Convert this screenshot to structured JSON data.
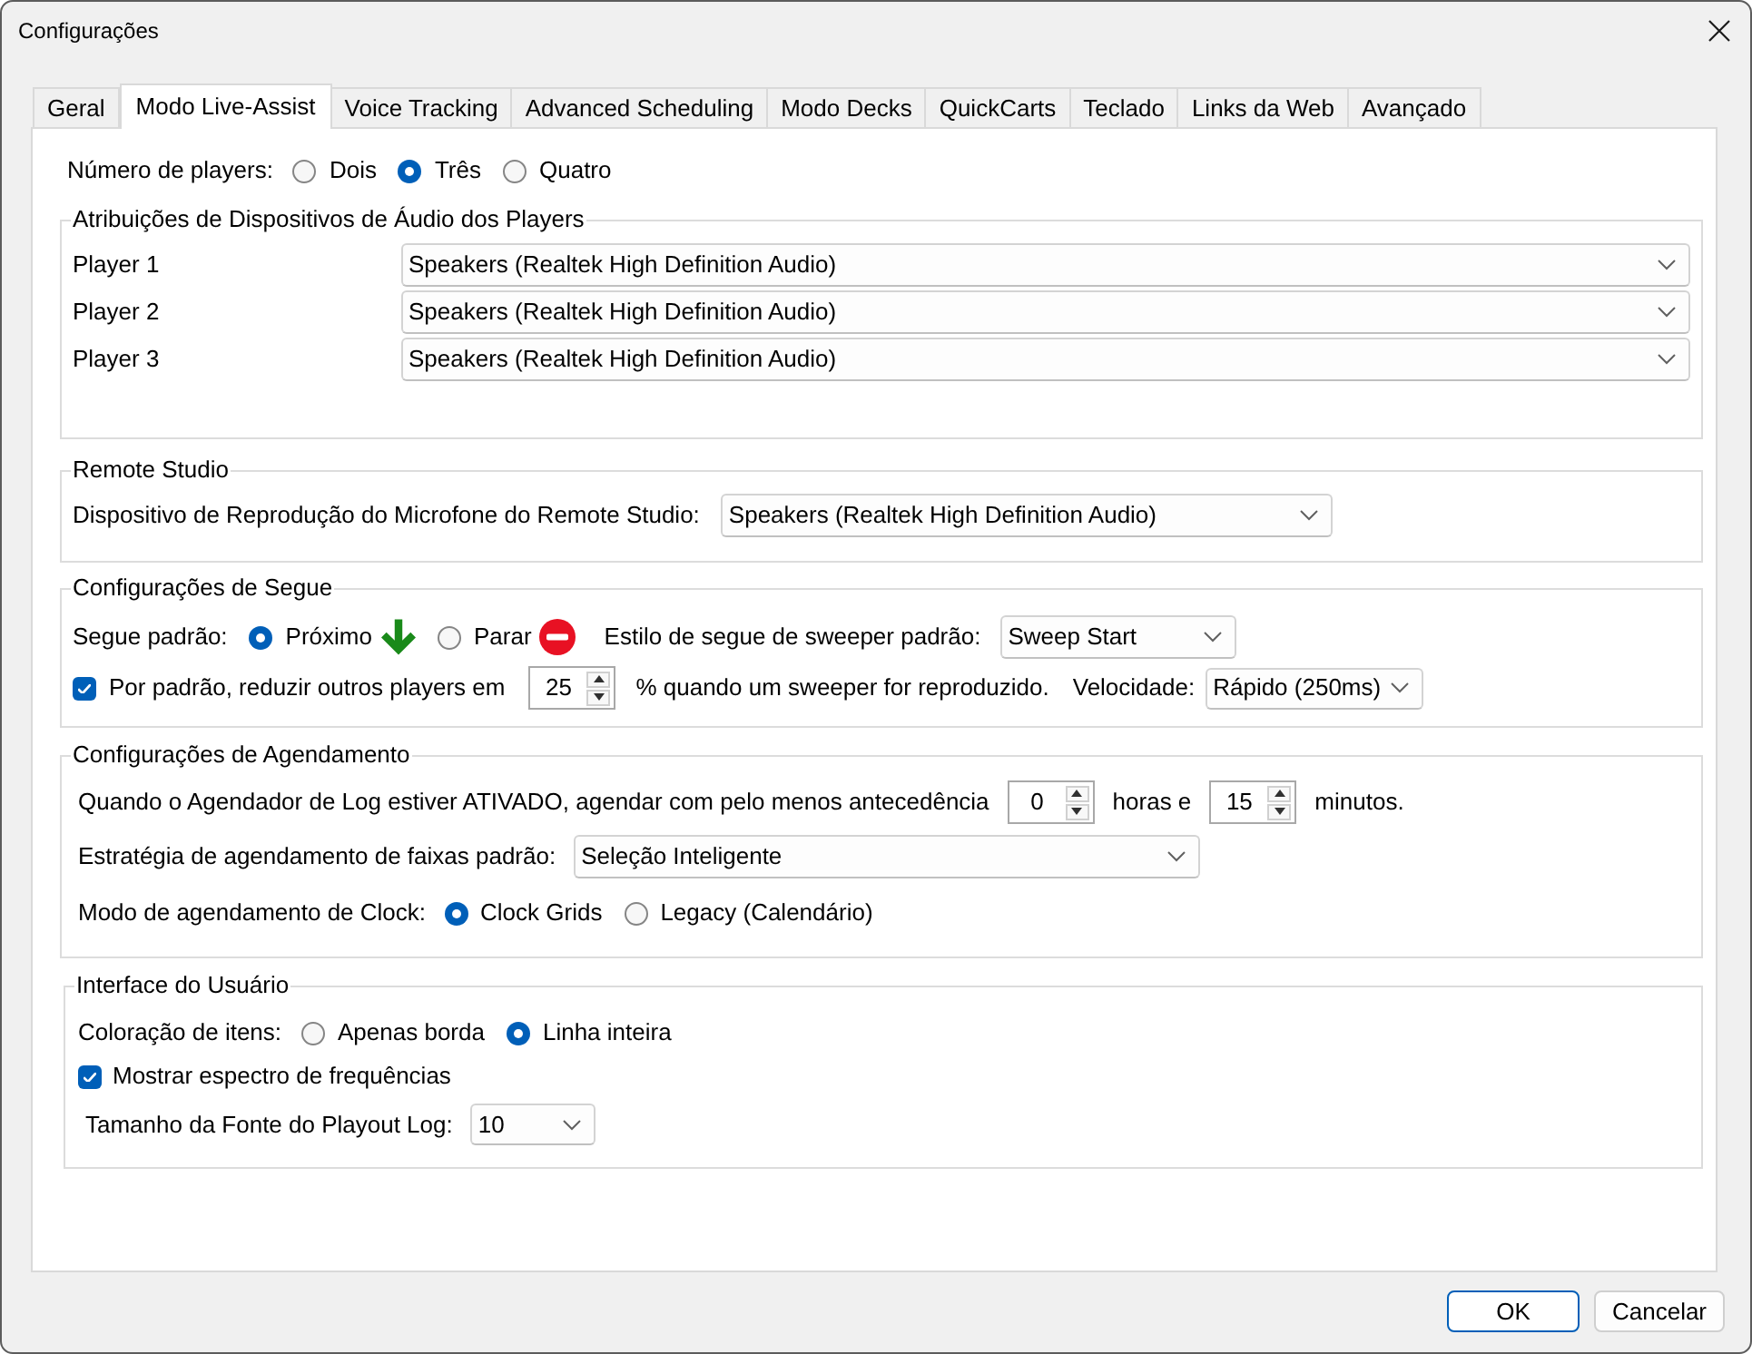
{
  "window": {
    "title": "Configurações"
  },
  "tabs": [
    {
      "label": "Geral",
      "selected": false
    },
    {
      "label": "Modo Live-Assist",
      "selected": true
    },
    {
      "label": "Voice Tracking",
      "selected": false
    },
    {
      "label": "Advanced Scheduling",
      "selected": false
    },
    {
      "label": "Modo Decks",
      "selected": false
    },
    {
      "label": "QuickCarts",
      "selected": false
    },
    {
      "label": "Teclado",
      "selected": false
    },
    {
      "label": "Links da Web",
      "selected": false
    },
    {
      "label": "Avançado",
      "selected": false
    }
  ],
  "players_count": {
    "label": "Número de players:",
    "options": [
      {
        "label": "Dois",
        "selected": false
      },
      {
        "label": "Três",
        "selected": true
      },
      {
        "label": "Quatro",
        "selected": false
      }
    ]
  },
  "audio_devices": {
    "title": "Atribuições de Dispositivos de Áudio dos Players",
    "rows": [
      {
        "label": "Player 1",
        "value": "Speakers (Realtek High Definition Audio)"
      },
      {
        "label": "Player 2",
        "value": "Speakers (Realtek High Definition Audio)"
      },
      {
        "label": "Player 3",
        "value": "Speakers (Realtek High Definition Audio)"
      }
    ]
  },
  "remote_studio": {
    "title": "Remote Studio",
    "label": "Dispositivo de Reprodução do Microfone do Remote Studio:",
    "value": "Speakers (Realtek High Definition Audio)"
  },
  "segue": {
    "title": "Configurações de Segue",
    "default_label": "Segue padrão:",
    "options": [
      {
        "label": "Próximo",
        "selected": true,
        "kind": "next"
      },
      {
        "label": "Parar",
        "selected": false,
        "kind": "stop"
      }
    ],
    "sweeper_label": "Estilo de segue de sweeper padrão:",
    "sweeper_value": "Sweep Start",
    "reduce": {
      "checked": true,
      "label": "Por padrão, reduzir outros players em",
      "value": "25",
      "suffix": "% quando um sweeper for reproduzido."
    },
    "speed_label": "Velocidade:",
    "speed_value": "Rápido (250ms)"
  },
  "scheduling": {
    "title": "Configurações de Agendamento",
    "lead_label": "Quando o Agendador de Log estiver ATIVADO, agendar com pelo menos antecedência",
    "hours_value": "0",
    "hours_label": "horas e",
    "minutes_value": "15",
    "minutes_label": "minutos.",
    "strategy_label": "Estratégia de agendamento de faixas padrão:",
    "strategy_value": "Seleção Inteligente",
    "clock_label": "Modo de agendamento de Clock:",
    "clock_options": [
      {
        "label": "Clock Grids",
        "selected": true
      },
      {
        "label": "Legacy (Calendário)",
        "selected": false
      }
    ]
  },
  "user_interface": {
    "title": "Interface do Usuário",
    "coloring_label": "Coloração de itens:",
    "coloring_options": [
      {
        "label": "Apenas borda",
        "selected": false
      },
      {
        "label": "Linha inteira",
        "selected": true
      }
    ],
    "spectrum": {
      "checked": true,
      "label": "Mostrar espectro de frequências"
    },
    "font_size_label": "Tamanho da Fonte do Playout Log:",
    "font_size_value": "10"
  },
  "buttons": [
    {
      "label": "OK",
      "default": true
    },
    {
      "label": "Cancelar",
      "default": false
    }
  ]
}
